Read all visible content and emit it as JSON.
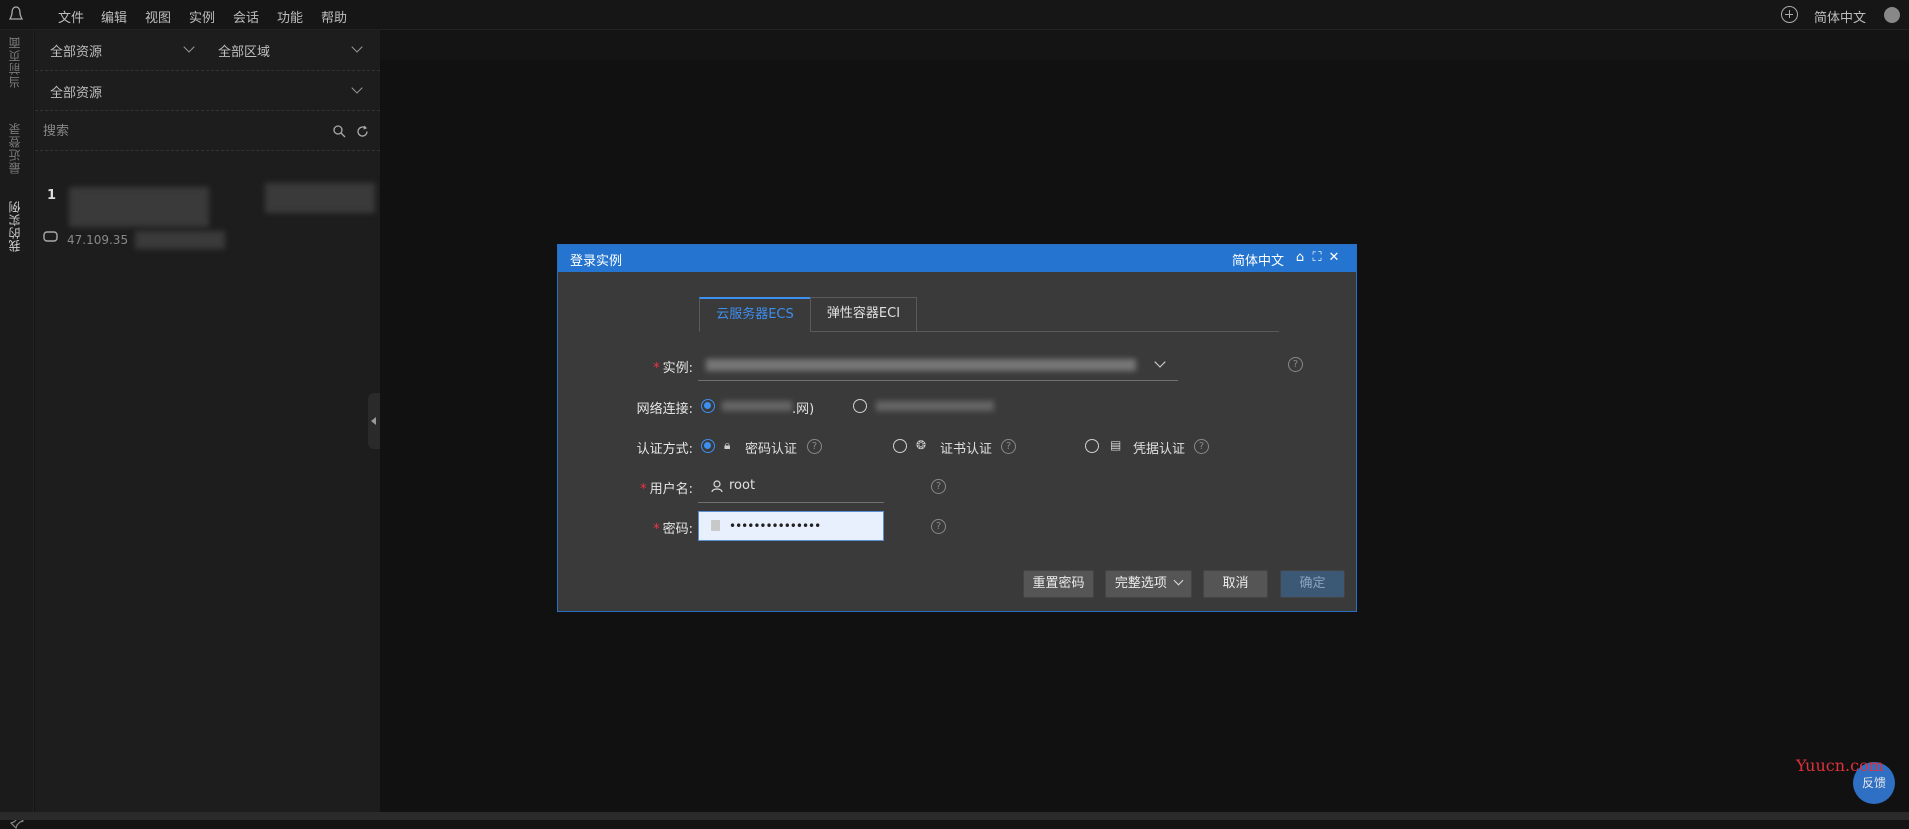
{
  "menubar": {
    "items": [
      "文件",
      "编辑",
      "视图",
      "实例",
      "会话",
      "功能",
      "帮助"
    ],
    "language": "简体中文"
  },
  "vertical_tabs": [
    "当前页面",
    "最近登录",
    "我的实例"
  ],
  "panel": {
    "resource_filter_1": "全部资源",
    "region_filter": "全部区域",
    "resource_filter_2": "全部资源",
    "search_placeholder": "搜索",
    "row_index": "1",
    "row_ip": "47.109.35"
  },
  "dialog": {
    "title": "登录实例",
    "language": "简体中文",
    "tabs": [
      "云服务器ECS",
      "弹性容器ECI"
    ],
    "labels": {
      "instance": "实例:",
      "network": "网络连接:",
      "auth": "认证方式:",
      "username": "用户名:",
      "password": "密码:"
    },
    "network_option": ".网)",
    "auth_options": [
      "密码认证",
      "证书认证",
      "凭据认证"
    ],
    "username_value": "root",
    "password_value": "•••••••••••••••",
    "buttons": {
      "reset": "重置密码",
      "options": "完整选项",
      "cancel": "取消",
      "confirm": "确定"
    }
  },
  "feedback": "反馈",
  "watermark": "Yuucn.com"
}
